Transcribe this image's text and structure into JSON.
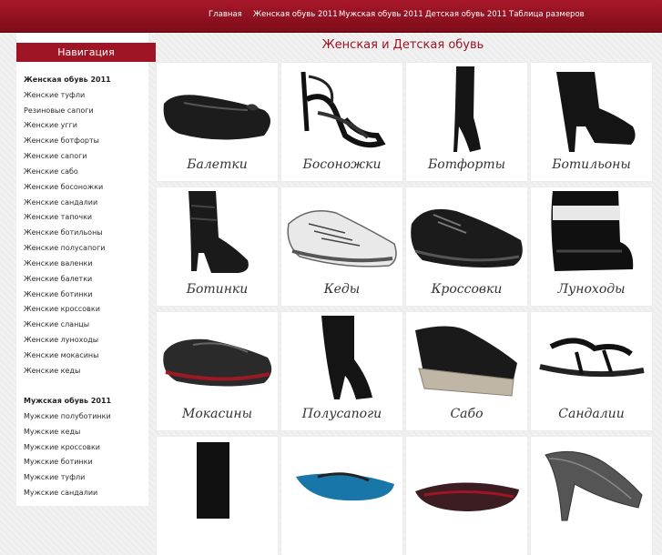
{
  "top_nav": [
    {
      "label": "Главная"
    },
    {
      "label": "Женская обувь 2011"
    },
    {
      "label": "Мужская обувь 2011"
    },
    {
      "label": "Детская обувь 2011"
    },
    {
      "label": "Таблица размеров"
    }
  ],
  "sidebar": {
    "title": "Навигация",
    "women_head": "Женская обувь 2011",
    "women_items": [
      "Женские туфли",
      "Резиновые сапоги",
      "Женские угги",
      "Женские ботфорты",
      "Женские сапоги",
      "Женские сабо",
      "Женские босоножки",
      "Женские сандалии",
      "Женские тапочки",
      "Женские ботильоны",
      "Женские полусапоги",
      "Женские валенки",
      "Женские балетки",
      "Женские ботинки",
      "Женские кроссовки",
      "Женские сланцы",
      "Женские луноходы",
      "Женские мокасины",
      "Женские кеды"
    ],
    "men_head": "Мужская обувь 2011",
    "men_items": [
      "Мужские полуботинки",
      "Мужские кеды",
      "Мужские кроссовки",
      "Мужские ботинки",
      "Мужские туфли",
      "Мужские сандалии"
    ]
  },
  "main": {
    "title": "Женская и Детская обувь",
    "products": [
      {
        "label": "Балетки",
        "icon": "ballet-flat-icon"
      },
      {
        "label": "Босоножки",
        "icon": "strappy-sandal-icon"
      },
      {
        "label": "Ботфорты",
        "icon": "thigh-boot-icon"
      },
      {
        "label": "Ботильоны",
        "icon": "ankle-bootie-icon"
      },
      {
        "label": "Ботинки",
        "icon": "ankle-boot-icon"
      },
      {
        "label": "Кеды",
        "icon": "sneaker-icon"
      },
      {
        "label": "Кроссовки",
        "icon": "trainer-icon"
      },
      {
        "label": "Луноходы",
        "icon": "moon-boot-icon"
      },
      {
        "label": "Мокасины",
        "icon": "moccasin-icon"
      },
      {
        "label": "Полусапоги",
        "icon": "mid-boot-icon"
      },
      {
        "label": "Сабо",
        "icon": "clog-icon"
      },
      {
        "label": "Сандалии",
        "icon": "sandal-icon"
      },
      {
        "label": "",
        "icon": "tall-boot-icon"
      },
      {
        "label": "",
        "icon": "flip-flop-icon"
      },
      {
        "label": "",
        "icon": "slipper-icon"
      },
      {
        "label": "",
        "icon": "pump-icon"
      }
    ]
  },
  "colors": {
    "brand": "#a01526",
    "text": "#2b2b2b"
  }
}
